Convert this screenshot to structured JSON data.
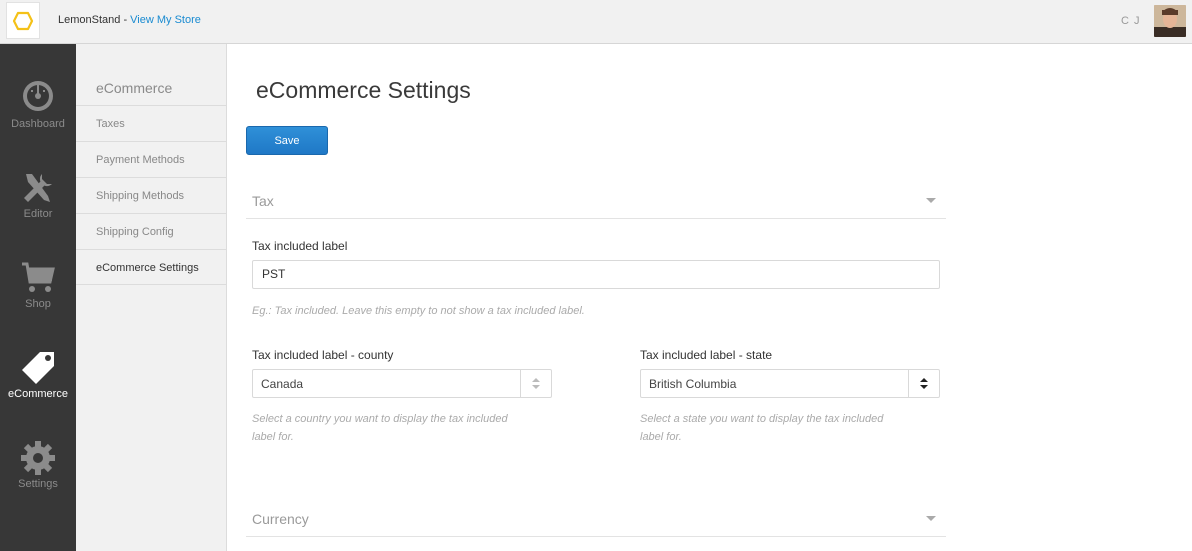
{
  "topbar": {
    "brand": "LemonStand",
    "separator": " - ",
    "store_link": "View My Store",
    "user_initials": "C J",
    "accent": "#1a8bd1",
    "logo_color": "#f4c118"
  },
  "rail": {
    "items": [
      {
        "label": "Dashboard",
        "icon": "gauge-icon"
      },
      {
        "label": "Editor",
        "icon": "tools-icon"
      },
      {
        "label": "Shop",
        "icon": "cart-icon"
      },
      {
        "label": "eCommerce",
        "icon": "tag-icon",
        "active": true
      },
      {
        "label": "Settings",
        "icon": "gear-icon"
      }
    ]
  },
  "subnav": {
    "title": "eCommerce",
    "items": [
      {
        "label": "Taxes"
      },
      {
        "label": "Payment Methods"
      },
      {
        "label": "Shipping Methods"
      },
      {
        "label": "Shipping Config"
      },
      {
        "label": "eCommerce Settings",
        "active": true
      }
    ]
  },
  "main": {
    "title": "eCommerce Settings",
    "save_label": "Save",
    "tax_section": {
      "title": "Tax",
      "tax_label": {
        "label": "Tax included label",
        "value": "PST",
        "hint": "Eg.: Tax included. Leave this empty to not show a tax included label."
      },
      "county": {
        "label": "Tax included label - county",
        "value": "Canada",
        "hint_line1": "Select a country you want to display the tax included",
        "hint_line2": "label for."
      },
      "state": {
        "label": "Tax included label - state",
        "value": "British Columbia",
        "hint_line1": "Select a state you want to display the tax included",
        "hint_line2": "label for."
      }
    },
    "currency_section": {
      "title": "Currency"
    }
  }
}
